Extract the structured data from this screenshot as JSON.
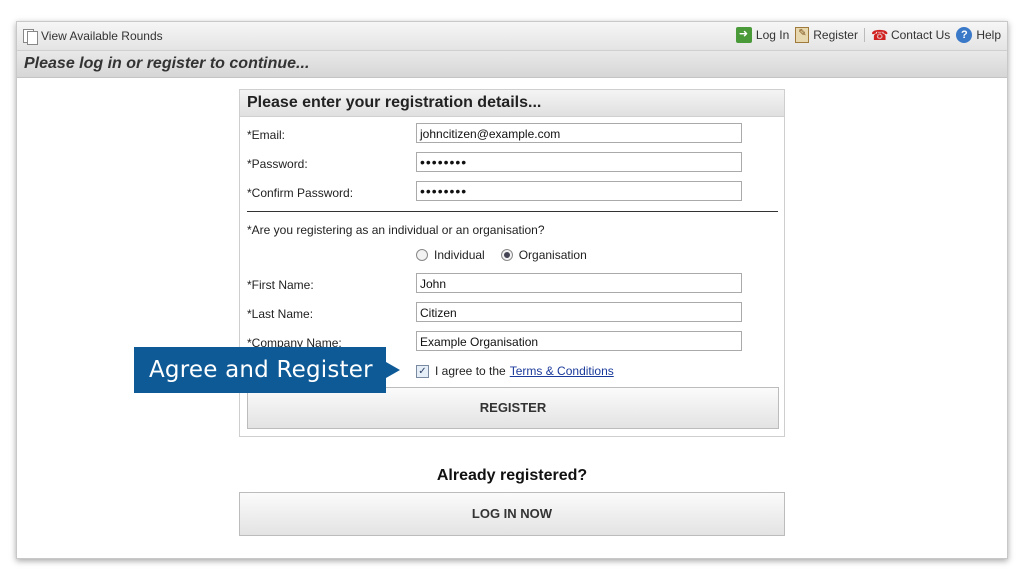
{
  "topbar": {
    "view_rounds": "View Available Rounds",
    "login": "Log In",
    "register": "Register",
    "contact": "Contact Us",
    "help": "Help",
    "help_glyph": "?"
  },
  "subbar": {
    "title": "Please log in or register to continue..."
  },
  "form": {
    "heading": "Please enter your registration details...",
    "email_label": "*Email:",
    "email_value": "johncitizen@example.com",
    "password_label": "*Password:",
    "password_value": "••••••••",
    "confirm_label": "*Confirm Password:",
    "confirm_value": "••••••••",
    "type_question": "*Are you registering as an individual or an organisation?",
    "individual_label": "Individual",
    "organisation_label": "Organisation",
    "selected_type": "Organisation",
    "first_name_label": "*First Name:",
    "first_name_value": "John",
    "last_name_label": "*Last Name:",
    "last_name_value": "Citizen",
    "company_label": "*Company Name:",
    "company_value": "Example Organisation",
    "agree_prefix": "I agree to the",
    "terms_link": "Terms & Conditions",
    "agree_checked": true,
    "register_button": "REGISTER"
  },
  "login_section": {
    "prompt": "Already registered?",
    "button": "LOG IN NOW"
  },
  "callout": {
    "text": "Agree and Register"
  },
  "colors": {
    "callout_bg": "#0d5a96",
    "link": "#1a3a9a"
  }
}
